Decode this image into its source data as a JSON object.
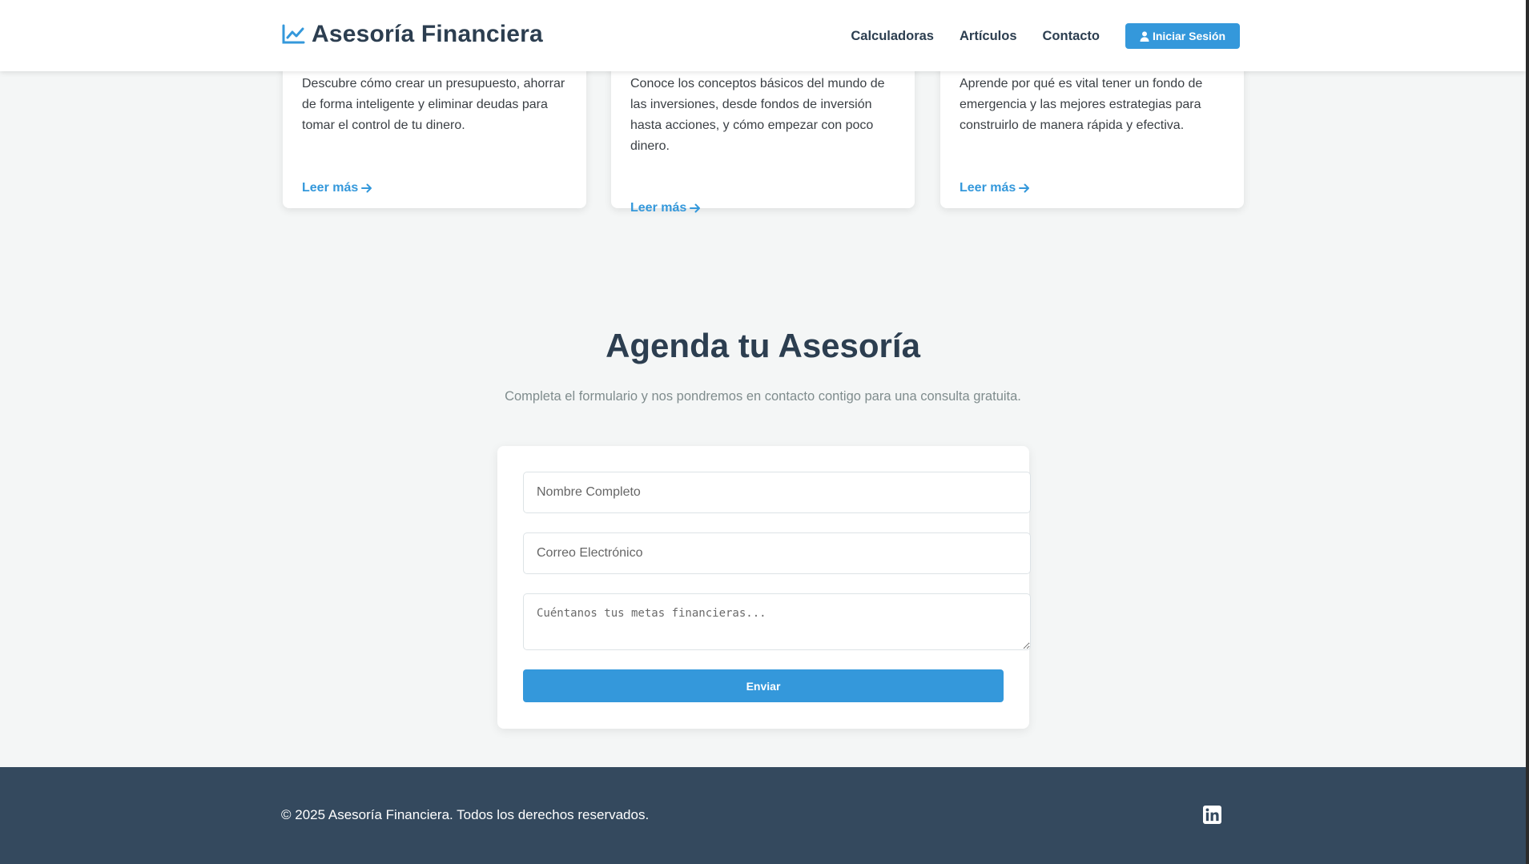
{
  "header": {
    "brand": "Asesoría Financiera",
    "brand_icon": "chart-line-icon",
    "nav": [
      "Calculadoras",
      "Artículos",
      "Contacto"
    ],
    "login_label": "Iniciar Sesión",
    "login_icon": "user-icon"
  },
  "articles": [
    {
      "text": "Descubre cómo crear un presupuesto, ahorrar de forma inteligente y eliminar deudas para tomar el control de tu dinero.",
      "link": "Leer más"
    },
    {
      "text": "Conoce los conceptos básicos del mundo de las inversiones, desde fondos de inversión hasta acciones, y cómo empezar con poco dinero.",
      "link": "Leer más"
    },
    {
      "text": "Aprende por qué es vital tener un fondo de emergencia y las mejores estrategias para construirlo de manera rápida y efectiva.",
      "link": "Leer más"
    }
  ],
  "contact": {
    "title": "Agenda tu Asesoría",
    "subtitle": "Completa el formulario y nos pondremos en contacto contigo para una consulta gratuita.",
    "name_placeholder": "Nombre Completo",
    "email_placeholder": "Correo Electrónico",
    "message_placeholder": "Cuéntanos tus metas financieras...",
    "submit_label": "Enviar"
  },
  "footer": {
    "copyright": "© 2025 Asesoría Financiera. Todos los derechos reservados.",
    "social_icon": "linkedin-icon"
  },
  "colors": {
    "accent": "#3498db",
    "heading": "#2c3e50",
    "footer_bg": "#34495e",
    "page_bg": "#f4f6f6"
  }
}
